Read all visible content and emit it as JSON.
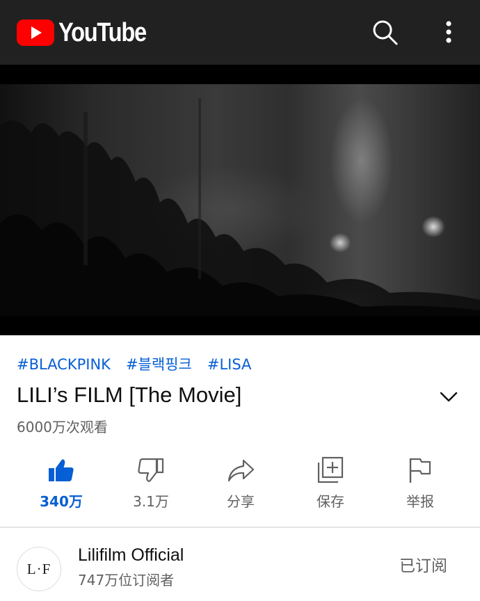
{
  "app": {
    "logo_text": "YouTube",
    "brand_color": "#ff0000",
    "icons": [
      "search-icon",
      "more-vert-icon"
    ]
  },
  "video": {
    "hashtags": [
      "#BLACKPINK",
      "#블랙핑크",
      "#LISA"
    ],
    "title": "LILI’s FILM [The Movie]",
    "views": "6000万次观看",
    "accent_color": "#065fd4"
  },
  "actions": {
    "like_count": "340万",
    "dislike_count": "3.1万",
    "share_label": "分享",
    "save_label": "保存",
    "report_label": "举报"
  },
  "channel": {
    "avatar_text": "L·F",
    "name": "Lilifilm Official",
    "subscribers": "747万位订阅者",
    "subscribe_state": "已订阅"
  }
}
